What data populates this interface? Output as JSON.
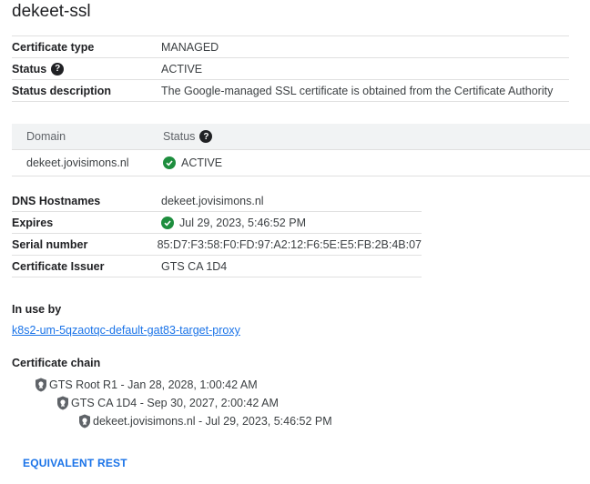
{
  "page": {
    "title": "dekeet-ssl"
  },
  "details": [
    {
      "key": "Certificate type",
      "value": "MANAGED"
    },
    {
      "key": "Status",
      "value": "ACTIVE"
    },
    {
      "key": "Status description",
      "value": "The Google-managed SSL certificate is obtained from the Certificate Authority"
    }
  ],
  "domains": {
    "headers": {
      "domain": "Domain",
      "status": "Status"
    },
    "rows": [
      {
        "domain": "dekeet.jovisimons.nl",
        "status": "ACTIVE"
      }
    ]
  },
  "details2": [
    {
      "key": "DNS Hostnames",
      "value": "dekeet.jovisimons.nl"
    },
    {
      "key": "Expires",
      "value": "Jul 29, 2023, 5:46:52 PM"
    },
    {
      "key": "Serial number",
      "value": "85:D7:F3:58:F0:FD:97:A2:12:F6:5E:E5:FB:2B:4B:07"
    },
    {
      "key": "Certificate Issuer",
      "value": "GTS CA 1D4"
    }
  ],
  "in_use": {
    "title": "In use by",
    "link": "k8s2-um-5qzaotqc-default-gat83-target-proxy"
  },
  "chain": {
    "title": "Certificate chain",
    "items": [
      "GTS Root R1 - Jan 28, 2028, 1:00:42 AM",
      "GTS CA 1D4 - Sep 30, 2027, 2:00:42 AM",
      "dekeet.jovisimons.nl - Jul 29, 2023, 5:46:52 PM"
    ]
  },
  "actions": {
    "equivalent_rest": "EQUIVALENT REST"
  },
  "colors": {
    "link": "#1a73e8",
    "success": "#1e8e3e",
    "header_bg": "#f1f3f4"
  }
}
